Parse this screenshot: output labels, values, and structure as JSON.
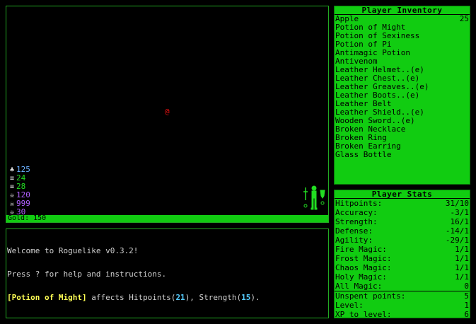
{
  "map": {
    "player_glyph": "@",
    "resources": [
      {
        "icon": "flask-icon",
        "glyph": "♣",
        "value": "125",
        "color": "#6ab0ff"
      },
      {
        "icon": "ladder-icon",
        "glyph": "≡",
        "value": "24",
        "color": "#22dd22"
      },
      {
        "icon": "ladder-icon",
        "glyph": "≡",
        "value": "28",
        "color": "#22dd22"
      },
      {
        "icon": "skull-icon",
        "glyph": "☠",
        "value": "120",
        "color": "#b060ff"
      },
      {
        "icon": "skull-icon",
        "glyph": "☠",
        "value": "999",
        "color": "#b060ff"
      },
      {
        "icon": "skull-icon",
        "glyph": "☠",
        "value": "30",
        "color": "#b060ff"
      }
    ],
    "gold": "Gold: 150"
  },
  "log": {
    "line1": "Welcome to Roguelike v0.3.2!",
    "line2": "Press ? for help and instructions.",
    "line3": {
      "item": "[Potion of Might]",
      "text_a": " affects Hitpoints(",
      "num_a": "21",
      "text_b": "), Strength(",
      "num_b": "15",
      "text_c": ")."
    }
  },
  "inventory": {
    "title": "Player Inventory",
    "items": [
      {
        "name": "Apple",
        "qty": "25"
      },
      {
        "name": "Potion of Might",
        "qty": ""
      },
      {
        "name": "Potion of Sexiness",
        "qty": ""
      },
      {
        "name": "Potion of Pi",
        "qty": ""
      },
      {
        "name": "Antimagic Potion",
        "qty": ""
      },
      {
        "name": "Antivenom",
        "qty": ""
      },
      {
        "name": "Leather Helmet..(e)",
        "qty": ""
      },
      {
        "name": "Leather Chest..(e)",
        "qty": ""
      },
      {
        "name": "Leather Greaves..(e)",
        "qty": ""
      },
      {
        "name": "Leather Boots..(e)",
        "qty": ""
      },
      {
        "name": "Leather Belt",
        "qty": ""
      },
      {
        "name": "Leather Shield..(e)",
        "qty": ""
      },
      {
        "name": "Wooden Sword..(e)",
        "qty": ""
      },
      {
        "name": "Broken Necklace",
        "qty": ""
      },
      {
        "name": "Broken Ring",
        "qty": ""
      },
      {
        "name": "Broken Earring",
        "qty": ""
      },
      {
        "name": "Glass Bottle",
        "qty": ""
      }
    ]
  },
  "stats": {
    "title": "Player Stats",
    "rows": [
      {
        "label": "Hitpoints:",
        "value": "31/10"
      },
      {
        "label": "Accuracy:",
        "value": "-3/1"
      },
      {
        "label": "Strength:",
        "value": "16/1"
      },
      {
        "label": "Defense:",
        "value": "-14/1"
      },
      {
        "label": "Agility:",
        "value": "-29/1"
      },
      {
        "label": "Fire Magic:",
        "value": "1/1"
      },
      {
        "label": "Frost Magic:",
        "value": "1/1"
      },
      {
        "label": "Chaos Magic:",
        "value": "1/1"
      },
      {
        "label": "Holy Magic:",
        "value": "1/1"
      },
      {
        "label": "All Magic:",
        "value": "0"
      }
    ],
    "footer": [
      {
        "label": "Unspent points:",
        "value": "5"
      },
      {
        "label": "Level:",
        "value": "1"
      },
      {
        "label": "XP to level:",
        "value": "6"
      }
    ]
  }
}
